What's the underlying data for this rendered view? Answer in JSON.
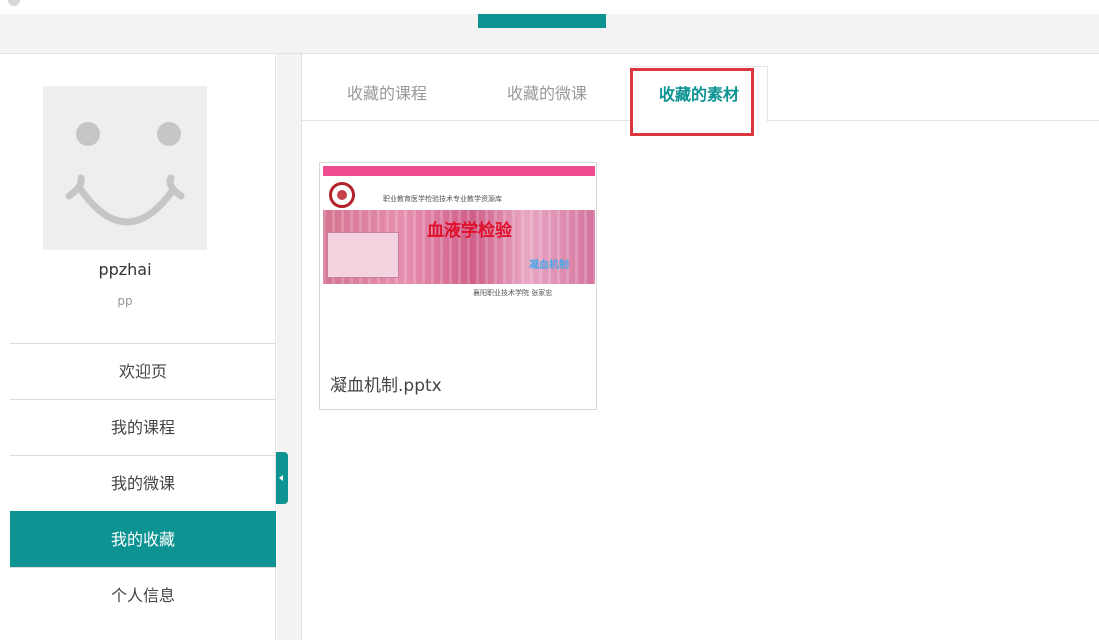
{
  "colors": {
    "accent": "#0e9393",
    "annotation_red": "#d9363e",
    "page_bg": "#f3f3f3"
  },
  "profile": {
    "username": "ppzhai",
    "nickname": "pp",
    "avatar_icon": "smiley-face-icon"
  },
  "sidebar": {
    "items": [
      {
        "label": "欢迎页",
        "active": false
      },
      {
        "label": "我的课程",
        "active": false
      },
      {
        "label": "我的微课",
        "active": false
      },
      {
        "label": "我的收藏",
        "active": true
      },
      {
        "label": "个人信息",
        "active": false
      }
    ]
  },
  "tabs": [
    {
      "label": "收藏的课程",
      "active": false
    },
    {
      "label": "收藏的微课",
      "active": false
    },
    {
      "label": "收藏的素材",
      "active": true
    }
  ],
  "materials": [
    {
      "filename": "凝血机制.pptx",
      "thumbnail": {
        "header": "职业教育医学检验技术专业教学资源库",
        "title": "血液学检验",
        "subtitle": "凝血机制",
        "footer": "襄阳职业技术学院  张家忠"
      }
    }
  ]
}
